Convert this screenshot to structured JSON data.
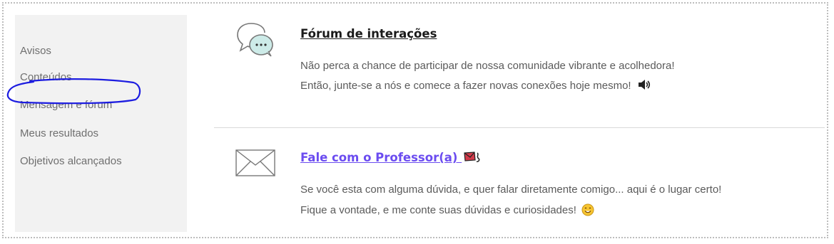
{
  "sidebar": {
    "items": [
      {
        "label": "Avisos"
      },
      {
        "label": "Conteúdos"
      },
      {
        "label": "Mensagem e fórum"
      },
      {
        "label": "Meus resultados"
      },
      {
        "label": "Objetivos alcançados"
      }
    ],
    "highlighted_item": "Mensagem e fórum",
    "highlight_color": "#1c1ce0"
  },
  "cards": [
    {
      "title": "Fórum de interações",
      "icon": "chat-bubbles-icon",
      "lines": [
        "Não perca a chance de participar de nossa comunidade vibrante e acolhedora!",
        "Então, junte-se a nós e comece a fazer novas conexões hoje mesmo!"
      ],
      "trailing_icon": "speaker-icon"
    },
    {
      "title": "Fale com o Professor(a)",
      "title_color": "#6b4cf0",
      "icon": "envelope-icon",
      "title_trailing_icon": "flying-envelope-icon",
      "lines": [
        "Se você esta com alguma dúvida, e quer falar diretamente comigo... aqui é o lugar certo!",
        "Fique a vontade, e me conte suas dúvidas e curiosidades!"
      ],
      "trailing_icon": "smiley-icon"
    }
  ]
}
